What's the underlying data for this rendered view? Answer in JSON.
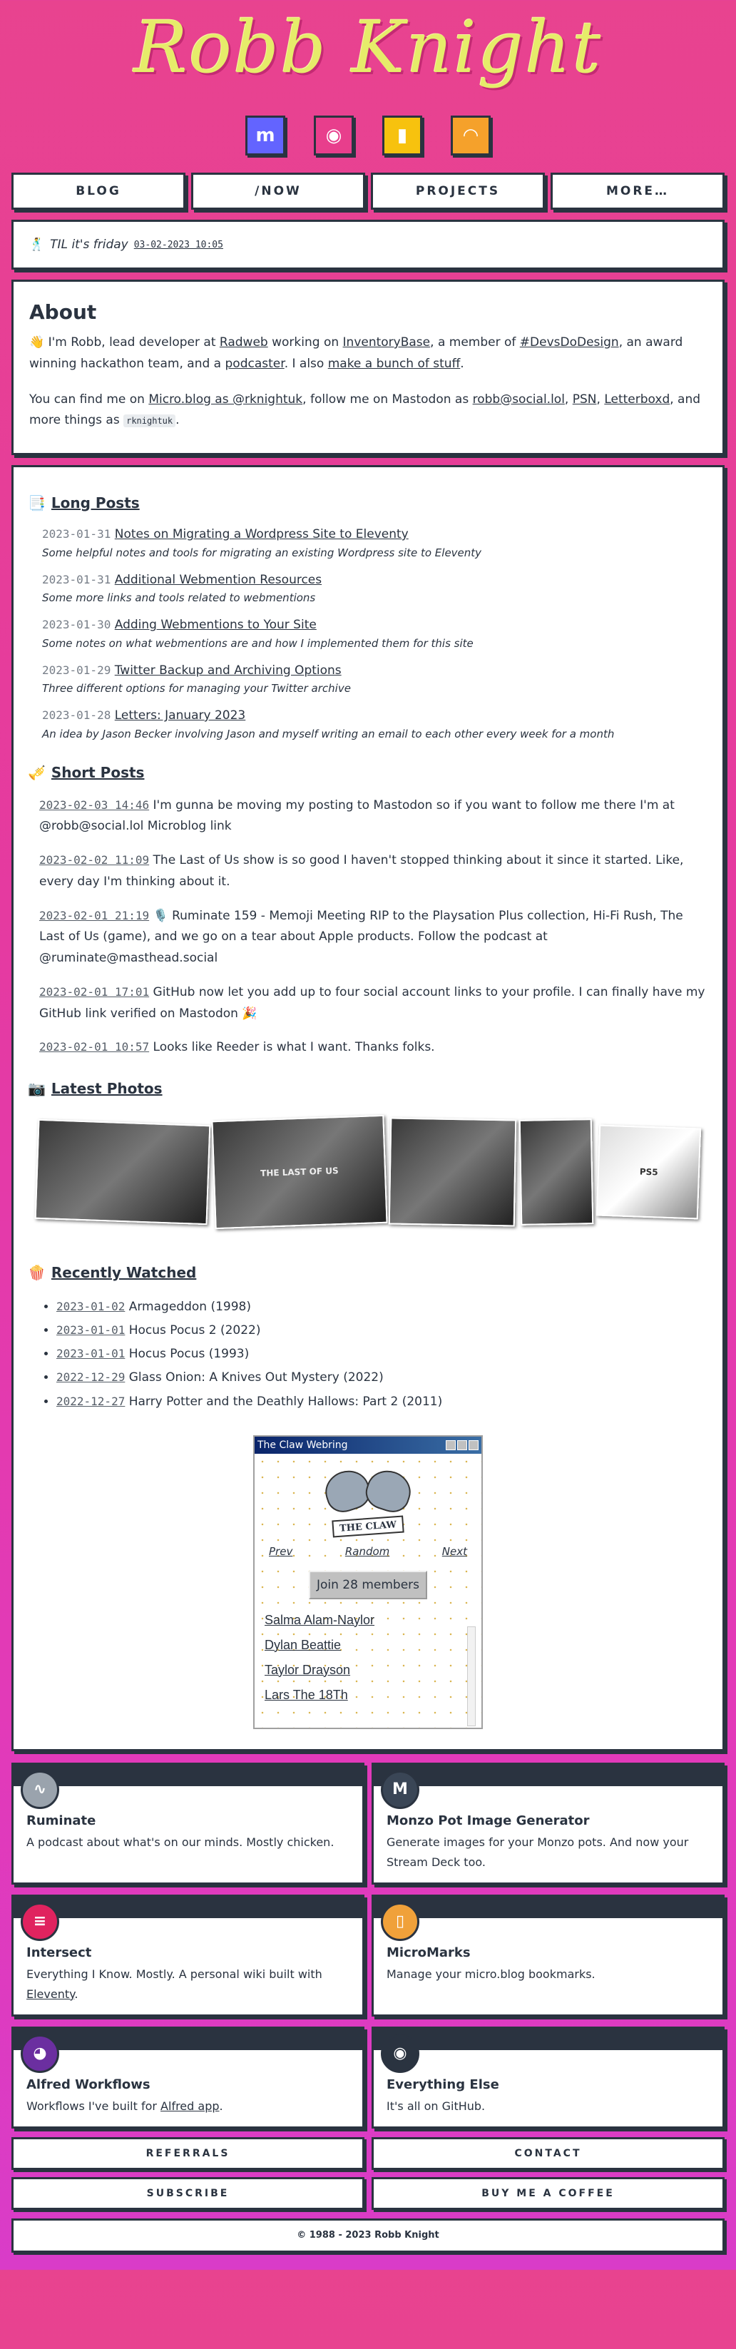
{
  "header": {
    "logo": "Robb Knight",
    "social": [
      {
        "name": "mastodon-icon",
        "glyph": "m",
        "color": "#6364ff"
      },
      {
        "name": "github-icon",
        "glyph": "◉",
        "color": "#e83e8c"
      },
      {
        "name": "untappd-icon",
        "glyph": "▮",
        "color": "#f7c20e"
      },
      {
        "name": "rss-icon",
        "glyph": "◠",
        "color": "#f5a12b"
      }
    ]
  },
  "nav": [
    "Blog",
    "/Now",
    "Projects",
    "More…"
  ],
  "til": {
    "emoji": "🕺",
    "text": "TIL it's friday",
    "date": "03-02-2023 10:05"
  },
  "about": {
    "title": "About",
    "p1_emoji": "👋",
    "p1_a": " I'm Robb, lead developer at ",
    "p1_link1": "Radweb",
    "p1_b": " working on ",
    "p1_link2": "InventoryBase",
    "p1_c": ", a member of ",
    "p1_link3": "#DevsDoDesign",
    "p1_d": ", an award winning hackathon team, and a ",
    "p1_link4": "podcaster",
    "p1_e": ". I also ",
    "p1_link5": "make a bunch of stuff",
    "p1_f": ".",
    "p2_a": "You can find me on ",
    "p2_link1": "Micro.blog as @rknightuk",
    "p2_b": ", follow me on Mastodon as ",
    "p2_link2": "robb@social.lol",
    "p2_c": ", ",
    "p2_link3": "PSN",
    "p2_d": ", ",
    "p2_link4": "Letterboxd",
    "p2_e": ", and more things as ",
    "p2_code": "rknightuk",
    "p2_f": "."
  },
  "long_posts": {
    "emoji": "📑",
    "title": "Long Posts",
    "items": [
      {
        "date": "2023-01-31",
        "title": "Notes on Migrating a Wordpress Site to Eleventy",
        "desc": "Some helpful notes and tools for migrating an existing Wordpress site to Eleventy"
      },
      {
        "date": "2023-01-31",
        "title": "Additional Webmention Resources",
        "desc": "Some more links and tools related to webmentions"
      },
      {
        "date": "2023-01-30",
        "title": "Adding Webmentions to Your Site",
        "desc": "Some notes on what webmentions are and how I implemented them for this site"
      },
      {
        "date": "2023-01-29",
        "title": "Twitter Backup and Archiving Options",
        "desc": "Three different options for managing your Twitter archive"
      },
      {
        "date": "2023-01-28",
        "title": "Letters: January 2023",
        "desc": "An idea by Jason Becker involving Jason and myself writing an email to each other every week for a month"
      }
    ]
  },
  "short_posts": {
    "emoji": "🎺",
    "title": "Short Posts",
    "items": [
      {
        "date": "2023-02-03 14:46",
        "text": "I'm gunna be moving my posting to Mastodon so if you want to follow me there I'm at @robb@social.lol Microblog link"
      },
      {
        "date": "2023-02-02 11:09",
        "text": "The Last of Us show is so good I haven't stopped thinking about it since it started. Like, every day I'm thinking about it."
      },
      {
        "date": "2023-02-01 21:19",
        "text": "🎙️ Ruminate 159 - Memoji Meeting RIP to the Playsation Plus collection, Hi-Fi Rush, The Last of Us (game), and we go on a tear about Apple products. Follow the podcast at @ruminate@masthead.social"
      },
      {
        "date": "2023-02-01 17:01",
        "text": "GitHub now let you add up to four social account links to your profile. I can finally have my GitHub link verified on Mastodon 🎉"
      },
      {
        "date": "2023-02-01 10:57",
        "text": "Looks like Reeder is what I want. Thanks folks."
      }
    ]
  },
  "photos": {
    "emoji": "📷",
    "title": "Latest Photos",
    "items": [
      {
        "label": ""
      },
      {
        "label": "THE LAST OF US"
      },
      {
        "label": ""
      },
      {
        "label": ""
      },
      {
        "label": "PS5"
      }
    ]
  },
  "recently_watched": {
    "emoji": "🍿",
    "title": "Recently Watched",
    "items": [
      {
        "date": "2023-01-02",
        "title": "Armageddon (1998)"
      },
      {
        "date": "2023-01-01",
        "title": "Hocus Pocus 2 (2022)"
      },
      {
        "date": "2023-01-01",
        "title": "Hocus Pocus (1993)"
      },
      {
        "date": "2022-12-29",
        "title": "Glass Onion: A Knives Out Mystery (2022)"
      },
      {
        "date": "2022-12-27",
        "title": "Harry Potter and the Deathly Hallows: Part 2 (2011)"
      }
    ]
  },
  "webring": {
    "title": "The Claw Webring",
    "banner": "THE CLAW",
    "prev": "Prev",
    "random": "Random",
    "next": "Next",
    "join": "Join 28 members",
    "members": [
      "Salma Alam-Naylor",
      "Dylan Beattie",
      "Taylor Drayson",
      "Lars The 18Th"
    ]
  },
  "projects": [
    {
      "icon": "ruminate-icon",
      "glyph": "∿",
      "color": "#9aa3ad",
      "title": "Ruminate",
      "desc": "A podcast about what's on our minds. Mostly chicken.",
      "link": ""
    },
    {
      "icon": "monzo-icon",
      "glyph": "M",
      "color": "#3a4656",
      "title": "Monzo Pot Image Generator",
      "desc": "Generate images for your Monzo pots. And now your Stream Deck too.",
      "link": ""
    },
    {
      "icon": "intersect-icon",
      "glyph": "≡",
      "color": "#e0235f",
      "title": "Intersect",
      "desc": "Everything I Know. Mostly. A personal wiki built with ",
      "link": "Eleventy",
      "after": "."
    },
    {
      "icon": "micromarks-icon",
      "glyph": "▯",
      "color": "#f0a13a",
      "title": "MicroMarks",
      "desc": "Manage your micro.blog bookmarks.",
      "link": ""
    },
    {
      "icon": "alfred-icon",
      "glyph": "◕",
      "color": "#6b2fa0",
      "title": "Alfred Workflows",
      "desc": "Workflows I've built for ",
      "link": "Alfred app",
      "after": "."
    },
    {
      "icon": "github-icon",
      "glyph": "◉",
      "color": "#2a3340",
      "title": "Everything Else",
      "desc": "It's all on GitHub.",
      "link": ""
    }
  ],
  "links": [
    "Referrals",
    "Contact",
    "Subscribe",
    "Buy Me a Coffee"
  ],
  "footer": "© 1988 - 2023 Robb Knight"
}
